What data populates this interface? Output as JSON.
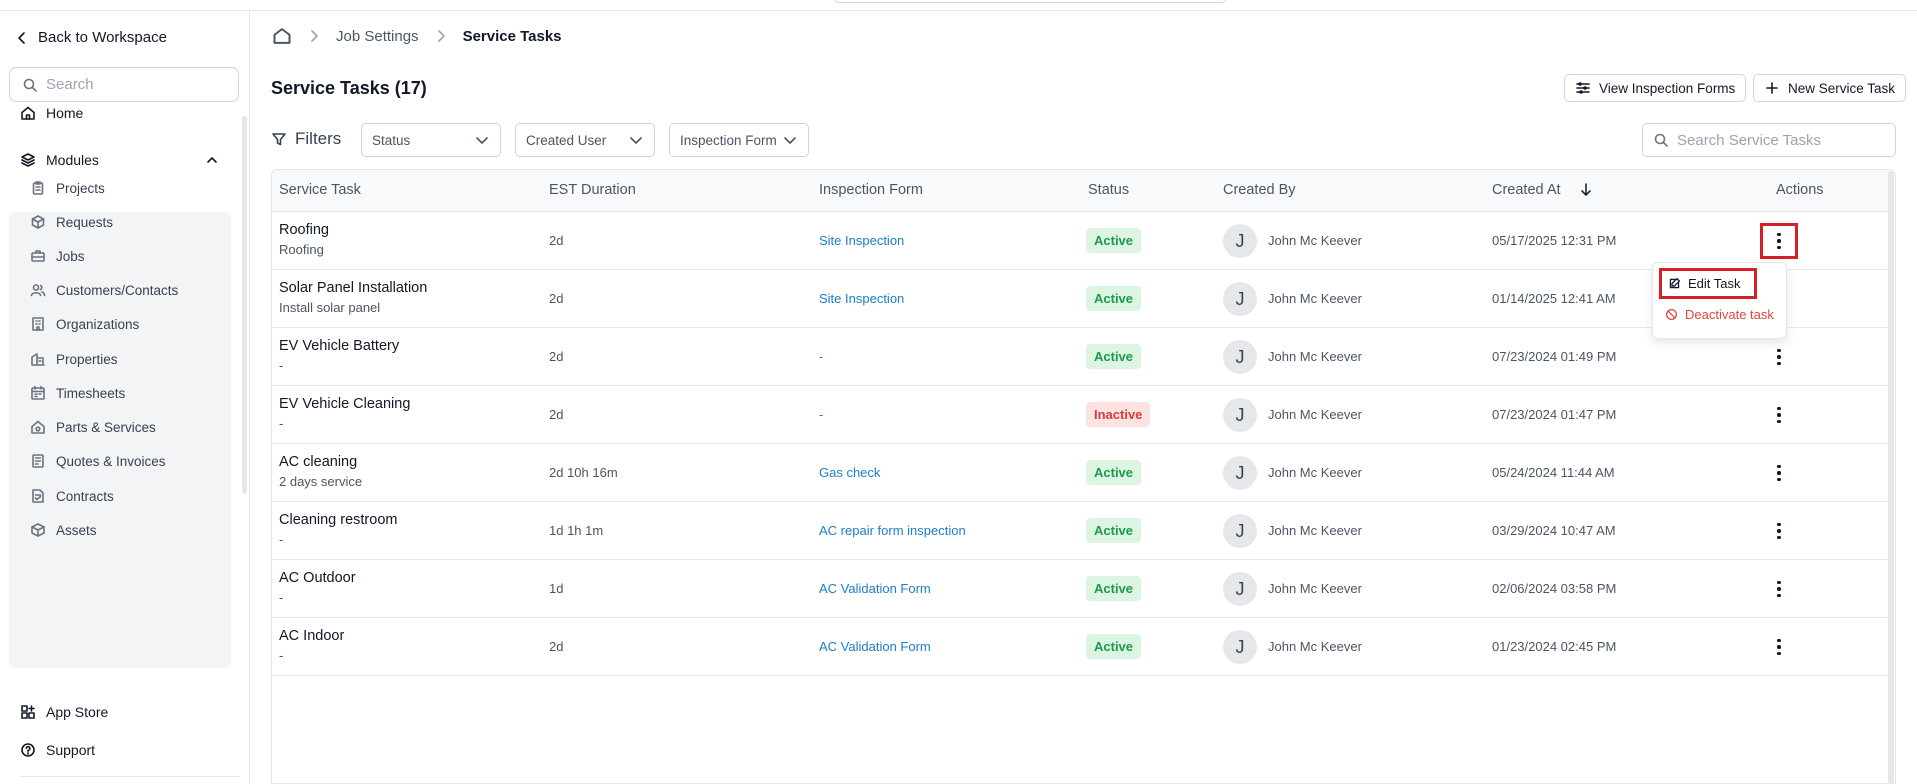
{
  "sidebar": {
    "back_label": "Back to Workspace",
    "search_placeholder": "Search",
    "home_label": "Home",
    "modules_label": "Modules",
    "modules_items": [
      {
        "label": "Projects",
        "icon": "clipboard-icon"
      },
      {
        "label": "Requests",
        "icon": "box-question-icon"
      },
      {
        "label": "Jobs",
        "icon": "briefcase-icon"
      },
      {
        "label": "Customers/Contacts",
        "icon": "users-icon"
      },
      {
        "label": "Organizations",
        "icon": "building-icon"
      },
      {
        "label": "Properties",
        "icon": "property-icon"
      },
      {
        "label": "Timesheets",
        "icon": "calendar-icon"
      },
      {
        "label": "Parts & Services",
        "icon": "house-gear-icon"
      },
      {
        "label": "Quotes & Invoices",
        "icon": "invoice-icon"
      },
      {
        "label": "Contracts",
        "icon": "contract-icon"
      },
      {
        "label": "Assets",
        "icon": "cube-icon"
      }
    ],
    "app_store_label": "App Store",
    "support_label": "Support"
  },
  "breadcrumb": {
    "home_icon": "home-icon",
    "parent": "Job Settings",
    "current": "Service Tasks"
  },
  "page": {
    "title": "Service Tasks (17)",
    "view_forms_label": "View Inspection Forms",
    "new_task_label": "New Service Task"
  },
  "filters": {
    "label": "Filters",
    "status": "Status",
    "created_user": "Created User",
    "inspection_form": "Inspection Form",
    "search_placeholder": "Search Service Tasks"
  },
  "table": {
    "headers": {
      "service_task": "Service Task",
      "duration": "EST Duration",
      "inspection_form": "Inspection Form",
      "status": "Status",
      "created_by": "Created By",
      "created_at": "Created At",
      "actions": "Actions"
    },
    "rows": [
      {
        "name": "Roofing",
        "desc": "Roofing",
        "duration": "2d",
        "form": "Site Inspection",
        "status": "Active",
        "avatar": "J",
        "created_by": "John Mc Keever",
        "created_at": "05/17/2025 12:31 PM"
      },
      {
        "name": "Solar Panel Installation",
        "desc": "Install solar panel",
        "duration": "2d",
        "form": "Site Inspection",
        "status": "Active",
        "avatar": "J",
        "created_by": "John Mc Keever",
        "created_at": "01/14/2025 12:41 AM"
      },
      {
        "name": "EV Vehicle Battery",
        "desc": "-",
        "duration": "2d",
        "form": "-",
        "status": "Active",
        "avatar": "J",
        "created_by": "John Mc Keever",
        "created_at": "07/23/2024 01:49 PM"
      },
      {
        "name": "EV Vehicle Cleaning",
        "desc": "-",
        "duration": "2d",
        "form": "-",
        "status": "Inactive",
        "avatar": "J",
        "created_by": "John Mc Keever",
        "created_at": "07/23/2024 01:47 PM"
      },
      {
        "name": "AC cleaning",
        "desc": "2 days service",
        "duration": "2d 10h 16m",
        "form": "Gas check",
        "status": "Active",
        "avatar": "J",
        "created_by": "John Mc Keever",
        "created_at": "05/24/2024 11:44 AM"
      },
      {
        "name": "Cleaning restroom",
        "desc": "-",
        "duration": "1d 1h 1m",
        "form": "AC repair form inspection",
        "status": "Active",
        "avatar": "J",
        "created_by": "John Mc Keever",
        "created_at": "03/29/2024 10:47 AM"
      },
      {
        "name": "AC Outdoor",
        "desc": "-",
        "duration": "1d",
        "form": "AC Validation Form",
        "status": "Active",
        "avatar": "J",
        "created_by": "John Mc Keever",
        "created_at": "02/06/2024 03:58 PM"
      },
      {
        "name": "AC Indoor",
        "desc": "-",
        "duration": "2d",
        "form": "AC Validation Form",
        "status": "Active",
        "avatar": "J",
        "created_by": "John Mc Keever",
        "created_at": "01/23/2024 02:45 PM"
      }
    ]
  },
  "menu": {
    "edit_label": "Edit Task",
    "deactivate_label": "Deactivate task"
  },
  "colors": {
    "link": "#1d7fc4",
    "active_bg": "#dcf5e3",
    "active_text": "#1e9a4a",
    "inactive_bg": "#fde2e2",
    "inactive_text": "#d63c3c",
    "highlight": "#d61f26"
  }
}
